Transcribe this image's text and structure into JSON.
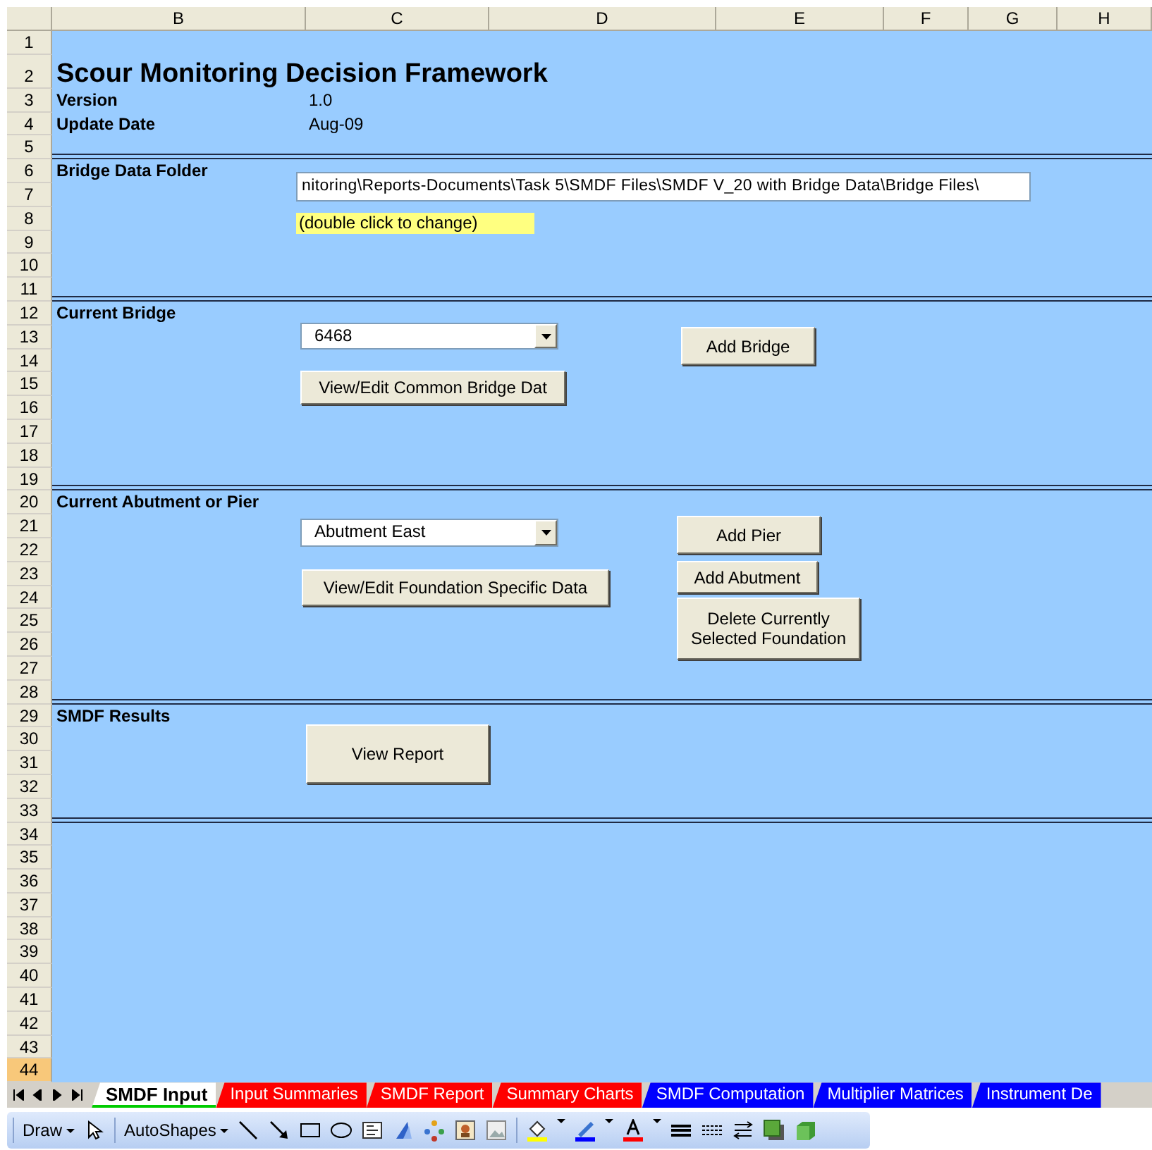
{
  "sheet": {
    "columns": [
      "B",
      "C",
      "D",
      "E",
      "F",
      "G",
      "H"
    ],
    "rows": [
      {
        "label": "1",
        "selected": false
      },
      {
        "label": "2",
        "selected": false
      },
      {
        "label": "3",
        "selected": false
      },
      {
        "label": "4",
        "selected": false
      },
      {
        "label": "5",
        "selected": false
      },
      {
        "label": "6",
        "selected": false
      },
      {
        "label": "7",
        "selected": false
      },
      {
        "label": "8",
        "selected": false
      },
      {
        "label": "9",
        "selected": false
      },
      {
        "label": "10",
        "selected": false
      },
      {
        "label": "11",
        "selected": false
      },
      {
        "label": "12",
        "selected": false
      },
      {
        "label": "13",
        "selected": false
      },
      {
        "label": "14",
        "selected": false
      },
      {
        "label": "15",
        "selected": false
      },
      {
        "label": "16",
        "selected": false
      },
      {
        "label": "17",
        "selected": false
      },
      {
        "label": "18",
        "selected": false
      },
      {
        "label": "19",
        "selected": false
      },
      {
        "label": "20",
        "selected": false
      },
      {
        "label": "21",
        "selected": false
      },
      {
        "label": "22",
        "selected": false
      },
      {
        "label": "23",
        "selected": false
      },
      {
        "label": "24",
        "selected": false
      },
      {
        "label": "25",
        "selected": false
      },
      {
        "label": "26",
        "selected": false
      },
      {
        "label": "27",
        "selected": false
      },
      {
        "label": "28",
        "selected": false
      },
      {
        "label": "29",
        "selected": false
      },
      {
        "label": "30",
        "selected": false
      },
      {
        "label": "31",
        "selected": false
      },
      {
        "label": "32",
        "selected": false
      },
      {
        "label": "33",
        "selected": false
      },
      {
        "label": "34",
        "selected": false
      },
      {
        "label": "35",
        "selected": false
      },
      {
        "label": "36",
        "selected": false
      },
      {
        "label": "37",
        "selected": false
      },
      {
        "label": "38",
        "selected": false
      },
      {
        "label": "39",
        "selected": false
      },
      {
        "label": "40",
        "selected": false
      },
      {
        "label": "41",
        "selected": false
      },
      {
        "label": "42",
        "selected": false
      },
      {
        "label": "43",
        "selected": false
      },
      {
        "label": "44",
        "selected": true
      }
    ],
    "title": "Scour Monitoring Decision Framework",
    "info": [
      {
        "label": "Version",
        "value": "1.0"
      },
      {
        "label": "Update Date",
        "value": "Aug-09"
      }
    ],
    "sections": [
      {
        "label": "Bridge Data Folder",
        "controls": [
          {
            "kind": "field",
            "value": "nitoring\\Reports-Documents\\Task 5\\SMDF Files\\SMDF V_20 with Bridge Data\\Bridge Files\\"
          },
          {
            "kind": "note",
            "text": "(double click to change)"
          }
        ]
      },
      {
        "label": "Current Bridge",
        "controls": [
          {
            "kind": "combo",
            "value": "6468"
          },
          {
            "kind": "button",
            "text": "View/Edit Common Bridge Dat"
          },
          {
            "kind": "button",
            "text": "Add Bridge"
          }
        ]
      },
      {
        "label": "Current Abutment or Pier",
        "controls": [
          {
            "kind": "combo",
            "value": "Abutment East"
          },
          {
            "kind": "button",
            "text": "View/Edit Foundation Specific Data"
          },
          {
            "kind": "button",
            "text": "Add Pier"
          },
          {
            "kind": "button",
            "text": "Add Abutment"
          },
          {
            "kind": "button",
            "text": "Delete Currently Selected Foundation"
          }
        ]
      },
      {
        "label": "SMDF Results",
        "controls": [
          {
            "kind": "button",
            "text": "View Report"
          }
        ]
      }
    ]
  },
  "sheet_tabs": [
    {
      "label": "SMDF Input",
      "selected": true,
      "color": "#00cc00"
    },
    {
      "label": "Input Summaries",
      "selected": false,
      "color": "#ff0000"
    },
    {
      "label": "SMDF Report",
      "selected": false,
      "color": "#ff0000"
    },
    {
      "label": "Summary Charts",
      "selected": false,
      "color": "#ff0000"
    },
    {
      "label": "SMDF Computation",
      "selected": false,
      "color": "#0000ff"
    },
    {
      "label": "Multiplier Matrices",
      "selected": false,
      "color": "#0000ff"
    },
    {
      "label": "Instrument De",
      "selected": false,
      "color": "#0000ff"
    }
  ],
  "drawing_toolbar": {
    "draw_menu": "Draw",
    "autoshapes_menu": "AutoShapes"
  }
}
